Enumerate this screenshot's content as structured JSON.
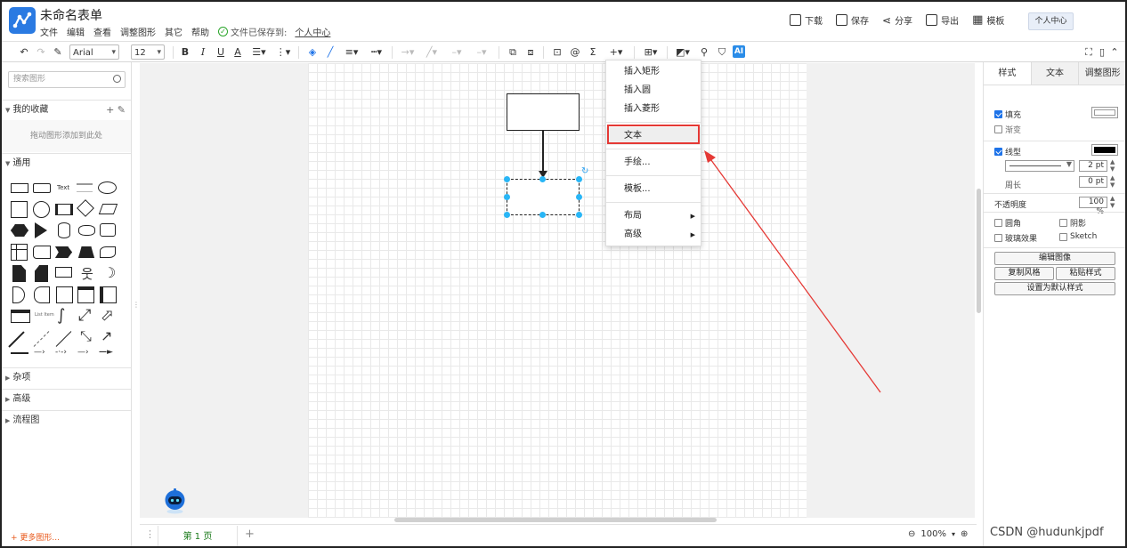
{
  "header": {
    "title": "未命名表单",
    "menu": [
      "文件",
      "编辑",
      "查看",
      "调整图形",
      "其它",
      "帮助"
    ],
    "saved_text": "文件已保存到:",
    "saved_location": "个人中心",
    "actions": [
      "下载",
      "保存",
      "分享",
      "导出",
      "模板"
    ],
    "user_center": "个人中心"
  },
  "toolbar": {
    "font_family": "Arial",
    "font_size": "12",
    "ai_label": "AI"
  },
  "sidebar": {
    "search_placeholder": "搜索图形",
    "favorites_label": "我的收藏",
    "drop_hint": "拖动图形添加到此处",
    "general_label": "通用",
    "shape_text": "Text",
    "sections": [
      "杂项",
      "高级",
      "流程图"
    ],
    "more_shapes": "+ 更多图形..."
  },
  "context_menu": {
    "items": [
      "插入矩形",
      "插入圆",
      "插入菱形",
      "文本",
      "手绘...",
      "模板...",
      "布局",
      "高级"
    ],
    "highlighted": "文本"
  },
  "bottom": {
    "page_tab": "第 1 页",
    "zoom": "100%"
  },
  "right_panel": {
    "tabs": [
      "样式",
      "文本",
      "调整图形"
    ],
    "fill_label": "填充",
    "gradient_label": "渐变",
    "line_label": "线型",
    "line_width": "2 pt",
    "perimeter_label": "周长",
    "perimeter_value": "0 pt",
    "opacity_label": "不透明度",
    "opacity_value": "100 %",
    "rounded_label": "圆角",
    "shadow_label": "阴影",
    "glass_label": "玻璃效果",
    "sketch_label": "Sketch",
    "edit_image": "编辑图像",
    "copy_style": "复制风格",
    "paste_style": "粘贴样式",
    "set_default": "设置为默认样式",
    "fill_color": "#ffffff",
    "line_color": "#000000"
  },
  "watermark": "CSDN @hudunkjpdf"
}
